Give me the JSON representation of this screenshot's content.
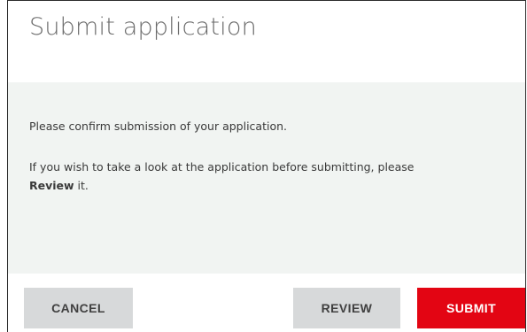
{
  "dialog": {
    "title": "Submit application",
    "message_line_1": "Please confirm submission of your application.",
    "message_line_2_prefix": "If you wish to take a look at the application before submitting, please",
    "review_link_text": "Review",
    "message_line_2_suffix": " it."
  },
  "footer": {
    "cancel_label": "CANCEL",
    "review_label": "REVIEW",
    "submit_label": "SUBMIT"
  },
  "colors": {
    "submit_accent": "#e30513",
    "secondary_button": "#d7d9da",
    "body_background": "#f1f4f2"
  }
}
